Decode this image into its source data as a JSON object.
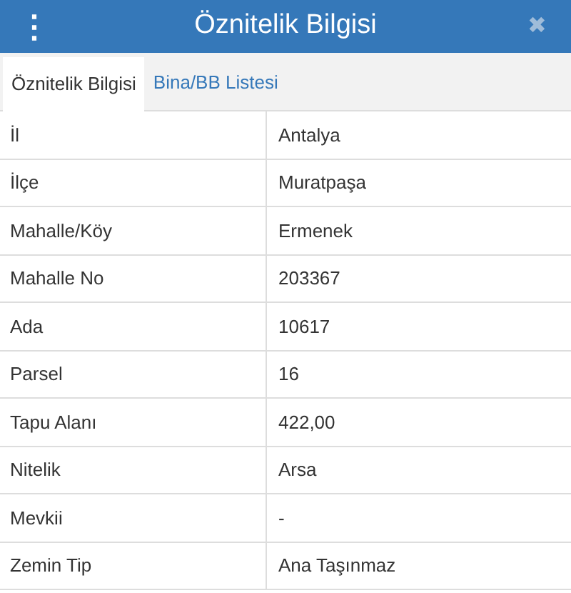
{
  "header": {
    "menu_glyph": "⋮",
    "title": "Öznitelik Bilgisi",
    "close_glyph": "✖"
  },
  "tabs": [
    {
      "label": "Öznitelik Bilgisi",
      "selected": true
    },
    {
      "label": "Bina/BB Listesi",
      "selected": false
    }
  ],
  "rows": [
    {
      "label": "İl",
      "value": "Antalya"
    },
    {
      "label": "İlçe",
      "value": "Muratpaşa"
    },
    {
      "label": "Mahalle/Köy",
      "value": "Ermenek"
    },
    {
      "label": "Mahalle No",
      "value": "203367"
    },
    {
      "label": "Ada",
      "value": "10617"
    },
    {
      "label": "Parsel",
      "value": "16"
    },
    {
      "label": "Tapu Alanı",
      "value": "422,00"
    },
    {
      "label": "Nitelik",
      "value": "Arsa"
    },
    {
      "label": "Mevkii",
      "value": "-"
    },
    {
      "label": "Zemin Tip",
      "value": "Ana Taşınmaz"
    }
  ]
}
